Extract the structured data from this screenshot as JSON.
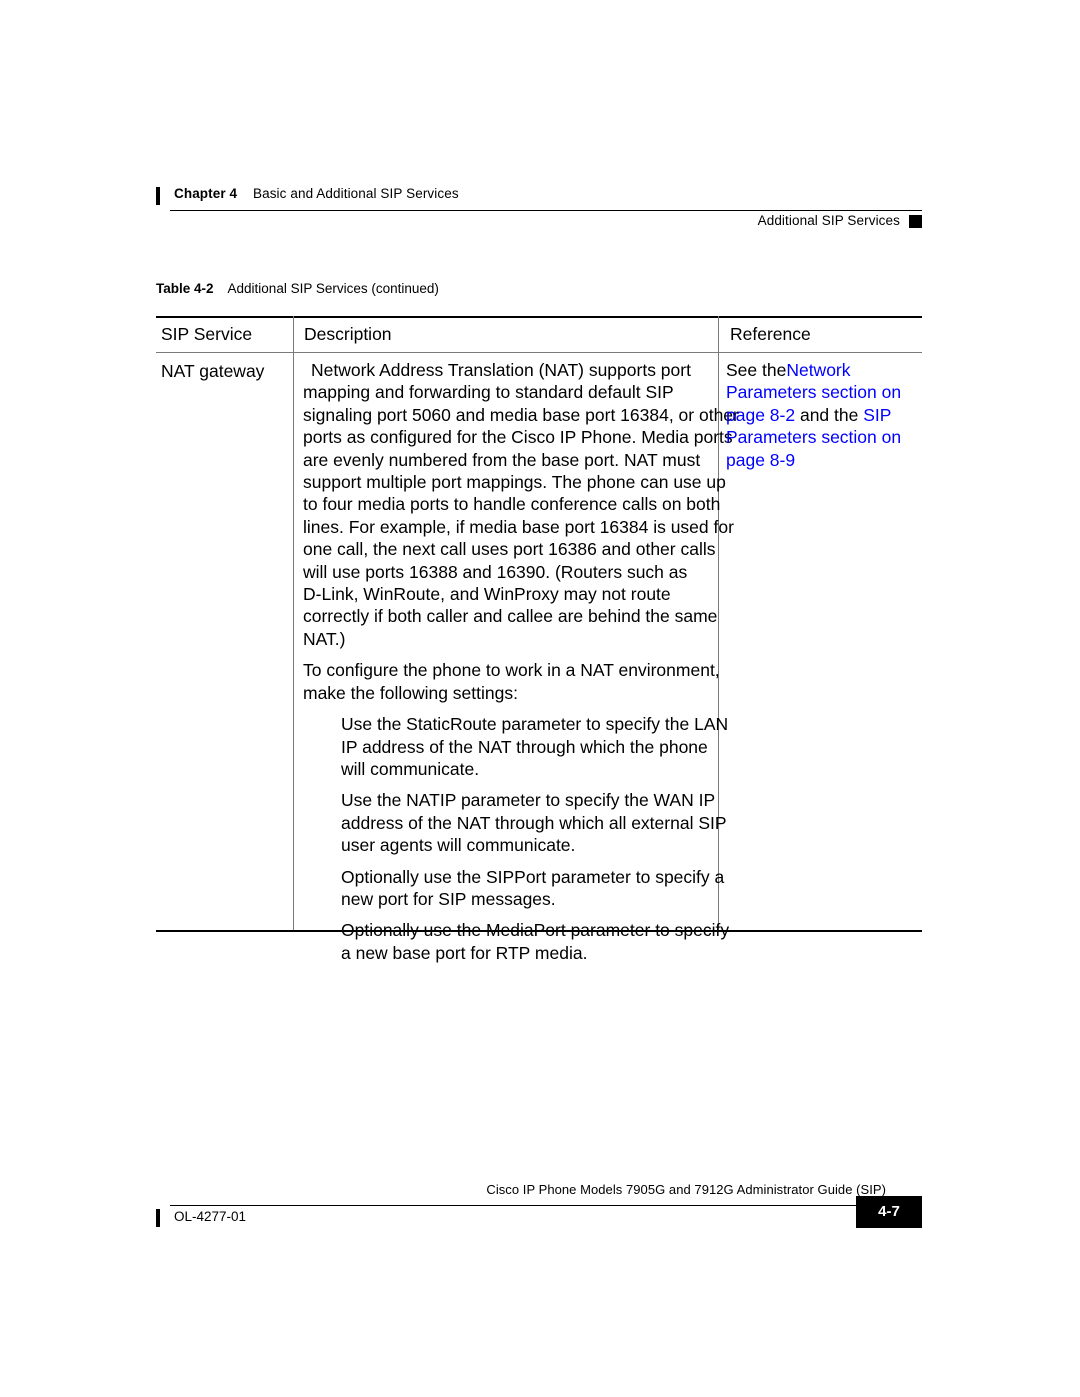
{
  "header": {
    "chapter_label": "Chapter 4",
    "chapter_title": "Basic and Additional SIP Services",
    "section_title": "Additional SIP Services"
  },
  "table": {
    "caption_number": "Table 4-2",
    "caption_text": "Additional SIP Services (continued)",
    "columns": [
      "SIP Service",
      "Description",
      "Reference"
    ],
    "row": {
      "service": "NAT gateway",
      "description_paragraphs": [
        "Network Address Translation (NAT) supports port",
        "mapping and forwarding to standard default SIP",
        "signaling port 5060 and media base port 16384, or other",
        "ports as configured for the Cisco IP Phone. Media ports",
        "are evenly numbered from the base port. NAT must",
        "support multiple port mappings. The phone can use up",
        "to four media ports to handle conference calls on both",
        "lines. For example, if media base port 16384 is used for",
        "one call, the next call uses port 16386 and other calls",
        "will use ports 16388 and 16390. (Routers such as",
        "D-Link, WinRoute, and WinProxy may not route",
        "correctly if both caller and callee are behind the same",
        "NAT.)"
      ],
      "description_intro": [
        "To configure the phone to work in a NAT environment,",
        "make the following settings:"
      ],
      "description_items": [
        [
          "Use the StaticRoute parameter to specify the LAN",
          "IP address of the NAT through which the phone",
          "will communicate."
        ],
        [
          "Use the NATIP parameter to specify the WAN IP",
          "address of the NAT through which all external SIP",
          "user agents will communicate."
        ],
        [
          "Optionally use the SIPPort parameter to specify a",
          "new port for SIP messages."
        ],
        [
          "Optionally use the MediaPort parameter to specify",
          "a new base port for RTP media."
        ]
      ],
      "reference_lines": [
        [
          {
            "t": "See the",
            "link": false
          },
          {
            "t": "Network",
            "link": true
          }
        ],
        [
          {
            "t": "Parameters",
            "link": true
          },
          {
            "t": " section on",
            "link": true
          }
        ],
        [
          {
            "t": "page 8-2",
            "link": true
          },
          {
            "t": " and the ",
            "link": false
          },
          {
            "t": "SIP",
            "link": true
          }
        ],
        [
          {
            "t": "Parameters",
            "link": true
          },
          {
            "t": " section on",
            "link": true
          }
        ],
        [
          {
            "t": "page 8-9",
            "link": true
          }
        ]
      ]
    }
  },
  "footer": {
    "guide_title": "Cisco IP Phone Models 7905G and 7912G Administrator Guide (SIP)",
    "doc_id": "OL-4277-01",
    "page_number": "4-7"
  },
  "colors": {
    "link": "#0000FF",
    "text": "#000000",
    "rule": "#000000"
  }
}
